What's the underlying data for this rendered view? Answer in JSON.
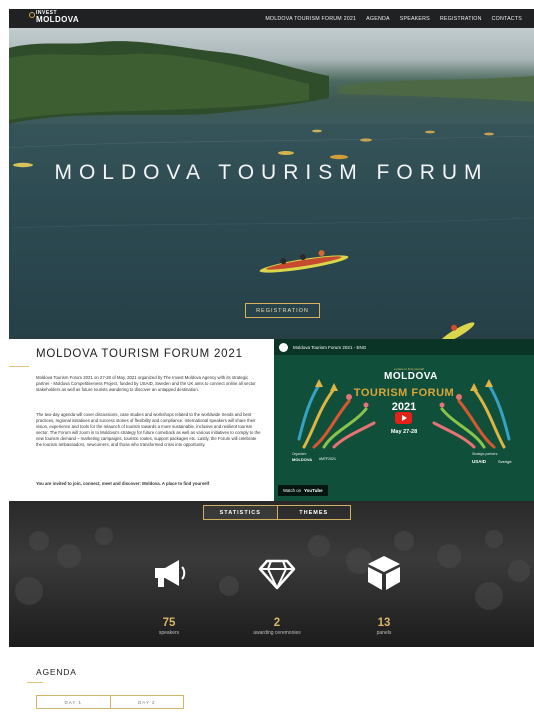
{
  "nav": {
    "logo_small": "INVEST",
    "logo_main": "MOLDOVA",
    "items": [
      "MOLDOVA TOURISM FORUM 2021",
      "AGENDA",
      "SPEAKERS",
      "REGISTRATION",
      "CONTACTS"
    ]
  },
  "hero": {
    "title": "MOLDOVA TOURISM FORUM",
    "button": "REGISTRATION"
  },
  "intro": {
    "heading": "MOLDOVA TOURISM FORUM 2021",
    "p1": "Moldova Tourism Forum 2021 on 27-28 of May, 2021 organized by The Invest Moldova Agency with its strategic partner - Moldova Competitiveness Project, funded by USAID, Sweden and the UK aims to connect online all sector stakeholders as well as future tourists wandering to discover an untapped destination.",
    "p2": "The two-day agenda will cover discussions, case studies and workshops related to the worldwide trends and best practices, regional initiatives and success stories of flexibility and compliance. International speakers will share their vision, experience and tools for the relaunch of tourism towards a more sustainable, inclusive and resilient tourism sector. The Forum will zoom in to Moldova's strategy for future comeback as well as various initiatives to comply to the new tourism demand – marketing campaigns, touristic routes, support packages etc. Lastly, the Forum will celebrate the tourism ambassadors, newcomers, and those who transformed crisis into opportunity.",
    "p3": "You are invited to join, connect, meet and discover: Moldova. A place to find yourself"
  },
  "video": {
    "title": "Moldova Tourism Forum 2021 - ENG",
    "brand_small": "a place to find yourself",
    "brand_main": "MOLDOVA",
    "forum": "TOURISM FORUM",
    "year": "2021",
    "dates": "May 27-28",
    "organizer_label": "Organizer:",
    "organizer": "MOLDOVA",
    "hashtag": "#MTF2021",
    "support_label": "Strategic partners:",
    "usaid": "USAID",
    "sweden": "Sverige",
    "watch_on": "Watch on",
    "youtube": "YouTube"
  },
  "stats": {
    "tabs": [
      "STATISTICS",
      "THEMES"
    ],
    "items": [
      {
        "value": "75",
        "label": "speakers",
        "icon": "megaphone-icon"
      },
      {
        "value": "2",
        "label": "awarding ceremonies",
        "icon": "diamond-icon"
      },
      {
        "value": "13",
        "label": "panels",
        "icon": "cube-icon"
      }
    ]
  },
  "agenda": {
    "title": "AGENDA",
    "days": [
      "DAY 1",
      "DAY 2"
    ]
  },
  "colors": {
    "accent_gold": "#d8b35c",
    "nav_bg": "#1f2122",
    "video_green": "#10503b",
    "youtube_red": "#e62117"
  }
}
